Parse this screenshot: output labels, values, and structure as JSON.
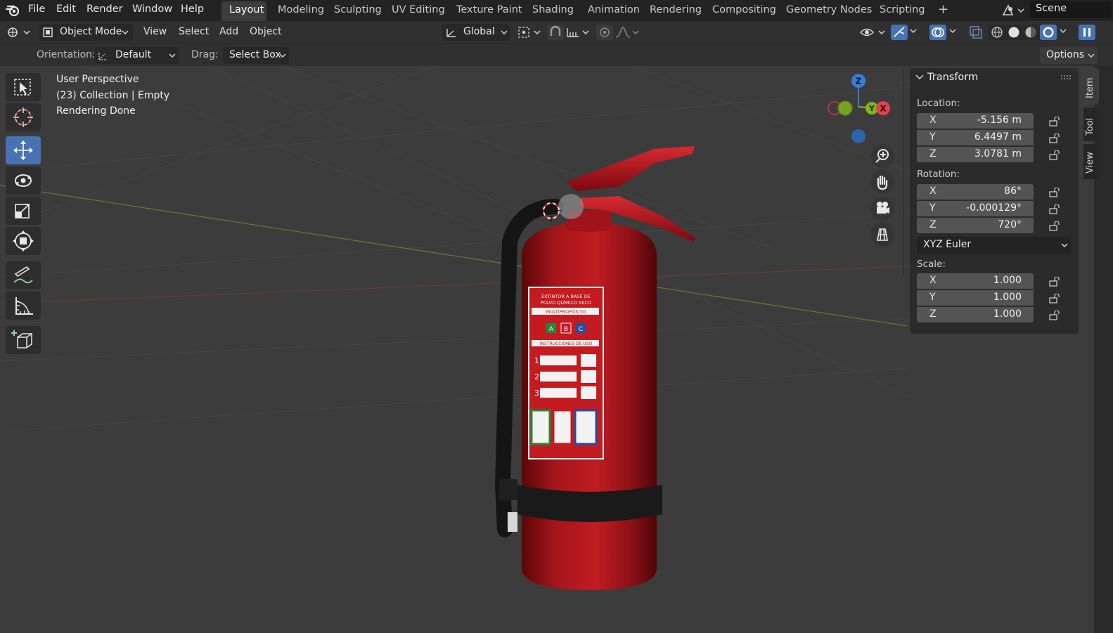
{
  "menubar": {
    "items": [
      "File",
      "Edit",
      "Render",
      "Window",
      "Help"
    ],
    "workspaces": [
      "Layout",
      "Modeling",
      "Sculpting",
      "UV Editing",
      "Texture Paint",
      "Shading",
      "Animation",
      "Rendering",
      "Compositing",
      "Geometry Nodes",
      "Scripting"
    ],
    "active_workspace": "Layout",
    "add_workspace": "+",
    "scene_name": "Scene"
  },
  "header": {
    "mode": "Object Mode",
    "menus": [
      "View",
      "Select",
      "Add",
      "Object"
    ],
    "transform_orientation": "Global"
  },
  "tool_settings": {
    "orientation_label": "Orientation:",
    "orientation_value": "Default",
    "drag_label": "Drag:",
    "drag_value": "Select Box",
    "options_label": "Options"
  },
  "viewport": {
    "overlay_lines": [
      "User Perspective",
      "(23) Collection | Empty",
      "Rendering Done"
    ],
    "gizmo": {
      "z": "Z",
      "x": "X",
      "y": "Y"
    },
    "object": "fire extinguisher",
    "label_lines": [
      "EXTINTOR A BASE DE",
      "POLVO QUÍMICO SECO",
      "MULTIPROPÓSITO",
      "INSTRUCCIONES DE USO"
    ],
    "label_classes": [
      "A",
      "B",
      "C"
    ],
    "label_steps": [
      "1",
      "2",
      "3"
    ]
  },
  "toolbar": {
    "tools": [
      "select-box",
      "cursor",
      "move",
      "rotate",
      "scale",
      "transform",
      "annotate",
      "measure",
      "add-cube"
    ],
    "active_tool": "move"
  },
  "transform_panel": {
    "title": "Transform",
    "location_label": "Location:",
    "location": {
      "x": "-5.156 m",
      "y": "6.4497 m",
      "z": "3.0781 m"
    },
    "rotation_label": "Rotation:",
    "rotation": {
      "x": "86°",
      "y": "-0.000129°",
      "z": "720°"
    },
    "rotation_mode": "XYZ Euler",
    "scale_label": "Scale:",
    "scale": {
      "x": "1.000",
      "y": "1.000",
      "z": "1.000"
    },
    "axis_labels": {
      "x": "X",
      "y": "Y",
      "z": "Z"
    }
  },
  "side_tabs": [
    "Item",
    "Tool",
    "View"
  ],
  "colors": {
    "accent": "#4772b3",
    "extinguisher_red": "#b5161b",
    "axis_x": "#e2424f",
    "axis_y": "#7fb51d",
    "axis_z": "#3a7fd5"
  }
}
